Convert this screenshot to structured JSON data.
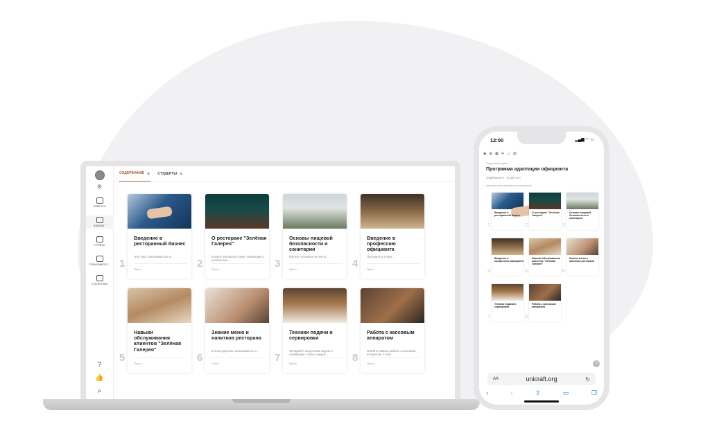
{
  "laptop": {
    "sidebar": {
      "items": [
        {
          "label": "НОВОСТИ",
          "icon": "news-icon"
        },
        {
          "label": "КАТАЛОГ",
          "icon": "catalog-icon"
        },
        {
          "label": "ГРУППЫ",
          "icon": "groups-icon"
        },
        {
          "label": "ПОЛЬЗОВАТЕЛ...",
          "icon": "users-icon"
        },
        {
          "label": "СТАТИСТИКА",
          "icon": "statistics-icon"
        }
      ],
      "bottom_icons": [
        "help-icon",
        "like-icon",
        "search-user-icon"
      ]
    },
    "tabs": [
      {
        "label": "СОДЕРЖАНИЕ",
        "count": "8"
      },
      {
        "label": "СТУДЕНТЫ",
        "count": "0"
      }
    ],
    "cards": [
      {
        "num": "1",
        "title": "Введение в ресторанный бизнес",
        "desc": "Этот курс познакомит вас в...",
        "foot": "Пусто"
      },
      {
        "num": "2",
        "title": "О ресторане \"Зелёная Галерея\"",
        "desc": "В курсе описана история, концепция и уникальные...",
        "foot": "Пусто"
      },
      {
        "num": "3",
        "title": "Основы пищевой безопасности и санитарии",
        "desc": "Изучите основные аспекты...",
        "foot": "Пусто"
      },
      {
        "num": "4",
        "title": "Введение в профессию официанта",
        "desc": "Погрузитесь в мир...",
        "foot": "Пусто"
      },
      {
        "num": "5",
        "title": "Навыки обслуживания клиентов \"Зелёная Галерея\"",
        "desc": "",
        "foot": "Пусто"
      },
      {
        "num": "6",
        "title": "Знание меню и напитков ресторана",
        "desc": "В этом курсе вы познакомитесь с...",
        "foot": "Пусто"
      },
      {
        "num": "7",
        "title": "Техники подачи и сервировки",
        "desc": "Овладейте искусством подачи и сервировки, чтобы каждый...",
        "foot": "Пусто"
      },
      {
        "num": "8",
        "title": "Работа с кассовым аппаратом",
        "desc": "Освойте навыки работы с кассовым аппаратом, чтобы...",
        "foot": "Пусто"
      }
    ]
  },
  "phone": {
    "time": "12:00",
    "crumb": "Содержание курса",
    "title": "Программа адаптации официанта",
    "tabs": [
      "СОДЕРЖАНИЕ 8",
      "СТУДЕНТЫ 0"
    ],
    "sub": "Адаптационная программа для официантов",
    "cards": [
      {
        "num": "1",
        "title": "Введение в ресторанный бизнес"
      },
      {
        "num": "2",
        "title": "О ресторане \"Зелёная Галерея\""
      },
      {
        "num": "3",
        "title": "Основы пищевой безопасности и санитарии"
      },
      {
        "num": "4",
        "title": "Введение в профессию официанта"
      },
      {
        "num": "5",
        "title": "Навыки обслуживания клиентов \"Зелёная Галерея\""
      },
      {
        "num": "6",
        "title": "Знание меню и напитков ресторана"
      },
      {
        "num": "7",
        "title": "Техники подачи и сервировки"
      },
      {
        "num": "8",
        "title": "Работа с кассовым аппаратом"
      }
    ],
    "url": "unicraft.org",
    "url_aa": "AA"
  }
}
